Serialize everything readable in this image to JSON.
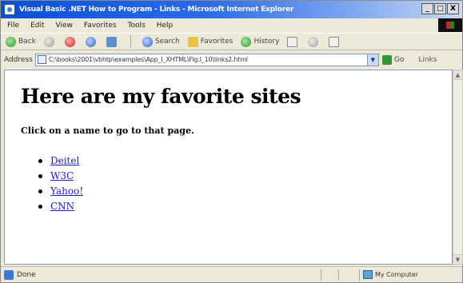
{
  "window": {
    "title": "Visual Basic .NET How to Program - Links - Microsoft Internet Explorer",
    "controls": [
      "_",
      "□",
      "X"
    ]
  },
  "menubar": {
    "items": [
      "File",
      "Edit",
      "View",
      "Favorites",
      "Tools",
      "Help"
    ]
  },
  "toolbar": {
    "back": "Back",
    "search": "Search",
    "favorites": "Favorites",
    "history": "History"
  },
  "addressbar": {
    "label": "Address",
    "value": "C:\\books\\2001\\vbhtp\\examples\\App_I_XHTML\\Fig.I_10\\links2.html",
    "go": "Go",
    "links": "Links"
  },
  "page": {
    "heading": "Here are my favorite sites",
    "instruction": "Click on a name to go to that page.",
    "links": [
      {
        "label": "Deitel"
      },
      {
        "label": "W3C"
      },
      {
        "label": "Yahoo!"
      },
      {
        "label": "CNN"
      }
    ]
  },
  "statusbar": {
    "text": "Done",
    "zone": "My Computer"
  }
}
